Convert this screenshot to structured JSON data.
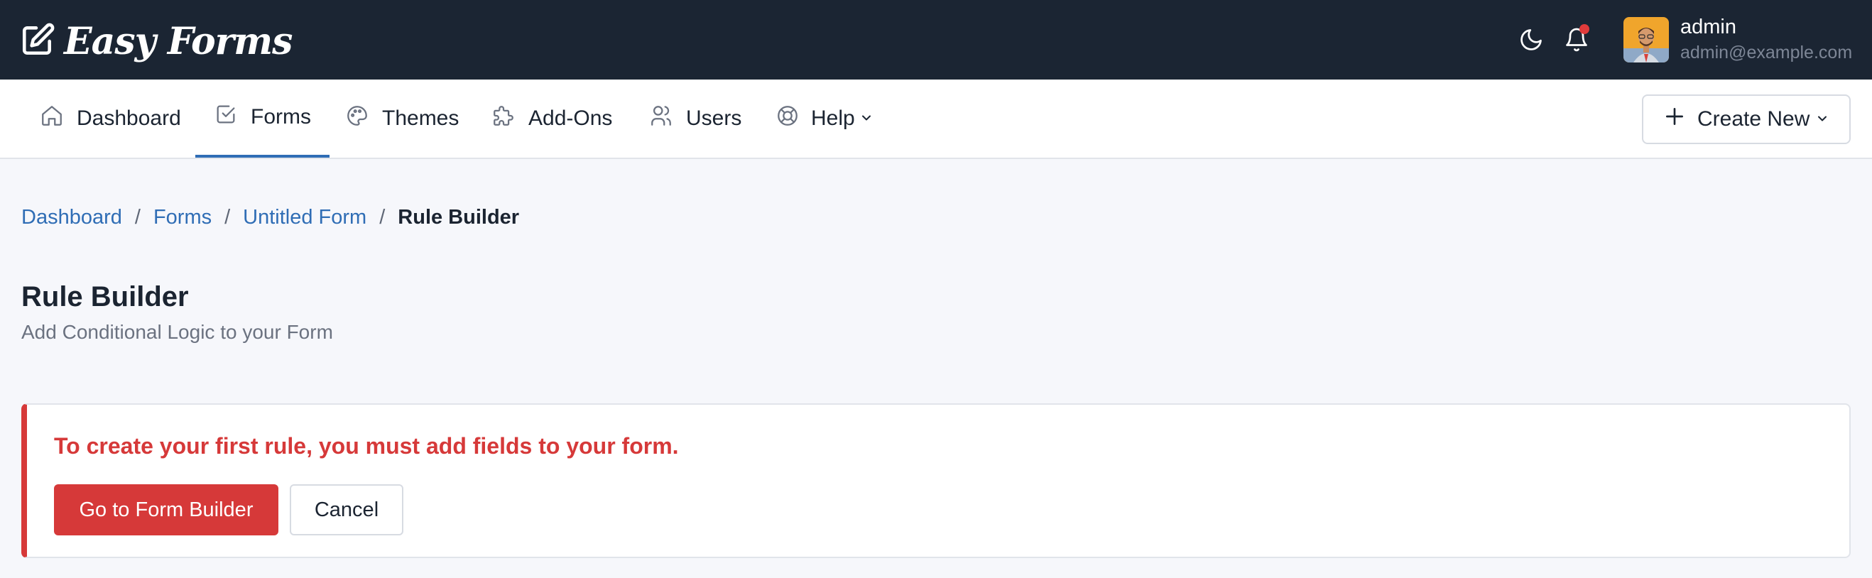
{
  "brand": {
    "name": "Easy Forms",
    "icon": "edit-square-icon"
  },
  "topbar": {
    "theme_icon": "moon-icon",
    "notifications_icon": "bell-icon",
    "notification_dot_color": "#e03b3b",
    "user": {
      "name": "admin",
      "email": "admin@example.com"
    }
  },
  "nav": {
    "items": [
      {
        "label": "Dashboard",
        "icon": "home-icon"
      },
      {
        "label": "Forms",
        "icon": "checkbox-icon",
        "active": true
      },
      {
        "label": "Themes",
        "icon": "palette-icon"
      },
      {
        "label": "Add-Ons",
        "icon": "puzzle-icon"
      },
      {
        "label": "Users",
        "icon": "users-icon"
      },
      {
        "label": "Help",
        "icon": "lifebuoy-icon",
        "has_dropdown": true
      }
    ],
    "create_new": "Create New"
  },
  "breadcrumb": {
    "items": [
      "Dashboard",
      "Forms",
      "Untitled Form"
    ],
    "current": "Rule Builder",
    "separator": "/"
  },
  "page": {
    "title": "Rule Builder",
    "subtitle": "Add Conditional Logic to your Form"
  },
  "alert": {
    "message": "To create your first rule, you must add fields to your form.",
    "primary_button": "Go to Form Builder",
    "cancel_button": "Cancel",
    "accent_color": "#d63939"
  },
  "colors": {
    "topbar_bg": "#1b2533",
    "link": "#2f6db5",
    "danger": "#d63939",
    "page_bg": "#f6f7fb"
  }
}
